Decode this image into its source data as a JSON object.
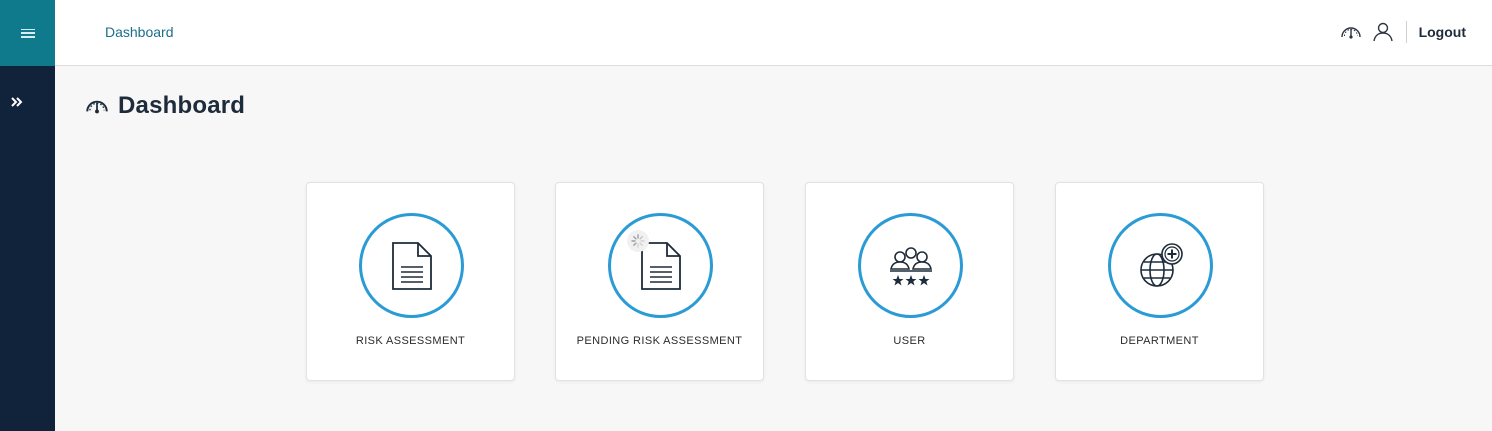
{
  "header": {
    "breadcrumb": "Dashboard",
    "logout_label": "Logout",
    "icons": [
      "dashboard-gauge-icon",
      "user-icon"
    ]
  },
  "sidebar": {
    "menu_icon": "hamburger-icon",
    "expand_icon": "double-chevron-right-icon"
  },
  "page": {
    "title": "Dashboard",
    "title_icon": "dashboard-gauge-icon"
  },
  "cards": [
    {
      "label": "RISK ASSESSMENT",
      "icon": "document-icon"
    },
    {
      "label": "PENDING RISK ASSESSMENT",
      "icon": "document-pending-icon"
    },
    {
      "label": "USER",
      "icon": "users-rating-icon"
    },
    {
      "label": "DEPARTMENT",
      "icon": "globe-plus-icon"
    }
  ],
  "colors": {
    "sidebar": "#10233a",
    "menu_button": "#0e7a8c",
    "accent": "#2a9bd4",
    "breadcrumb": "#1a6f8a",
    "text_dark": "#1d2b3a"
  }
}
